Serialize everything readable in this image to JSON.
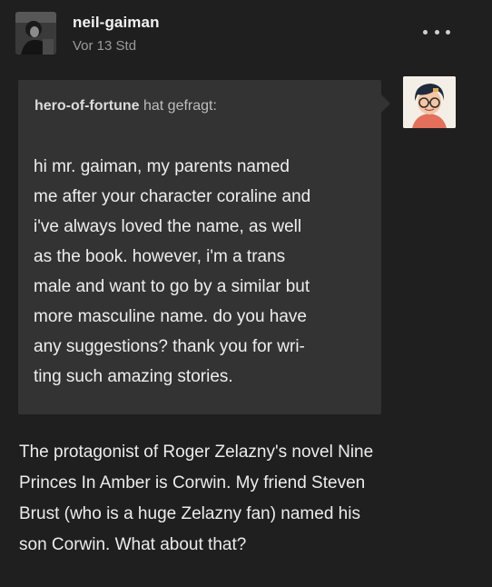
{
  "post": {
    "username": "neil-gaiman",
    "timestamp": "Vor 13 Std",
    "more_icon": "more-horizontal-icon"
  },
  "ask": {
    "asker": "hero-of-fortune",
    "asked_label": "hat gefragt:",
    "question_lines": [
      "hi mr. gaiman, my parents named",
      "me after your character coraline and",
      "i've always loved the name, as well",
      "as the book. however, i'm a trans",
      "male and want to go by a similar but",
      "more masculine name. do you have",
      "any suggestions? thank you for wri-",
      "ting such amazing stories."
    ]
  },
  "answer": {
    "lines": [
      "The protagonist of Roger Zelazny's novel Nine",
      "Princes In Amber is Corwin. My friend Steven",
      "Brust (who is a huge Zelazny fan) named his",
      "son Corwin. What about that?"
    ]
  },
  "colors": {
    "background": "#1f1f20",
    "ask_box": "#333334",
    "text": "#ececec",
    "muted": "#9b9b9b"
  }
}
